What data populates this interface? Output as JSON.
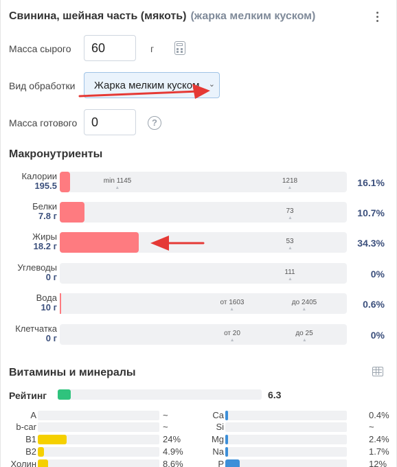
{
  "header": {
    "title": "Свинина, шейная часть (мякоть)",
    "subtitle": "(жарка мелким куском)"
  },
  "form": {
    "raw_mass_label": "Масса сырого",
    "raw_mass_value": "60",
    "raw_mass_unit": "г",
    "processing_label": "Вид обработки",
    "processing_value": "Жарка мелким куском",
    "cooked_mass_label": "Масса готового",
    "cooked_mass_value": "0",
    "help_glyph": "?"
  },
  "macros": {
    "title": "Макронутриенты",
    "rows": [
      {
        "name": "Калории",
        "value": "195.5",
        "fill_pct": 3.5,
        "pct": "16.1%",
        "marks": [
          {
            "label": "min 1145"
          },
          {
            "label": "1218"
          }
        ]
      },
      {
        "name": "Белки",
        "value": "7.8 г",
        "fill_pct": 8.5,
        "pct": "10.7%",
        "marks": [
          {
            "label": "73"
          }
        ]
      },
      {
        "name": "Жиры",
        "value": "18.2 г",
        "fill_pct": 27.5,
        "pct": "34.3%",
        "marks": [
          {
            "label": "53"
          }
        ]
      },
      {
        "name": "Углеводы",
        "value": "0 г",
        "fill_pct": 0,
        "pct": "0%",
        "marks": [
          {
            "label": "111"
          }
        ]
      },
      {
        "name": "Вода",
        "value": "10 г",
        "fill_pct": 0.5,
        "pct": "0.6%",
        "marks": [
          {
            "label": "от 1603"
          },
          {
            "label": "до 2405"
          }
        ]
      },
      {
        "name": "Клетчатка",
        "value": "0 г",
        "fill_pct": 0,
        "pct": "0%",
        "marks": [
          {
            "label": "от 20"
          },
          {
            "label": "до 25"
          }
        ]
      }
    ]
  },
  "vitamins": {
    "title": "Витамины и минералы",
    "rating_label": "Рейтинг",
    "rating_value": "6.3",
    "left": [
      {
        "name": "A",
        "pct": "~",
        "fill": 0,
        "color": "#f5d000"
      },
      {
        "name": "b-car",
        "pct": "~",
        "fill": 0,
        "color": "#f5d000"
      },
      {
        "name": "B1",
        "pct": "24%",
        "fill": 24,
        "color": "#f5d000"
      },
      {
        "name": "B2",
        "pct": "4.9%",
        "fill": 4.9,
        "color": "#f5d000"
      },
      {
        "name": "Холин",
        "pct": "8.6%",
        "fill": 8.6,
        "color": "#f5d000"
      }
    ],
    "right": [
      {
        "name": "Ca",
        "pct": "0.4%",
        "fill": 0.4,
        "color": "#3d8fd8"
      },
      {
        "name": "Si",
        "pct": "~",
        "fill": 0,
        "color": "#3d8fd8"
      },
      {
        "name": "Mg",
        "pct": "2.4%",
        "fill": 2.4,
        "color": "#3d8fd8"
      },
      {
        "name": "Na",
        "pct": "1.7%",
        "fill": 1.7,
        "color": "#3d8fd8"
      },
      {
        "name": "P",
        "pct": "12%",
        "fill": 12,
        "color": "#3d8fd8"
      }
    ]
  },
  "colors": {
    "macro_fill": "#fe7b80",
    "rating_fill": "#2fc37d",
    "vitamin_fill": "#f5d000",
    "mineral_fill": "#3d8fd8",
    "annotation_arrow": "#e53935"
  }
}
